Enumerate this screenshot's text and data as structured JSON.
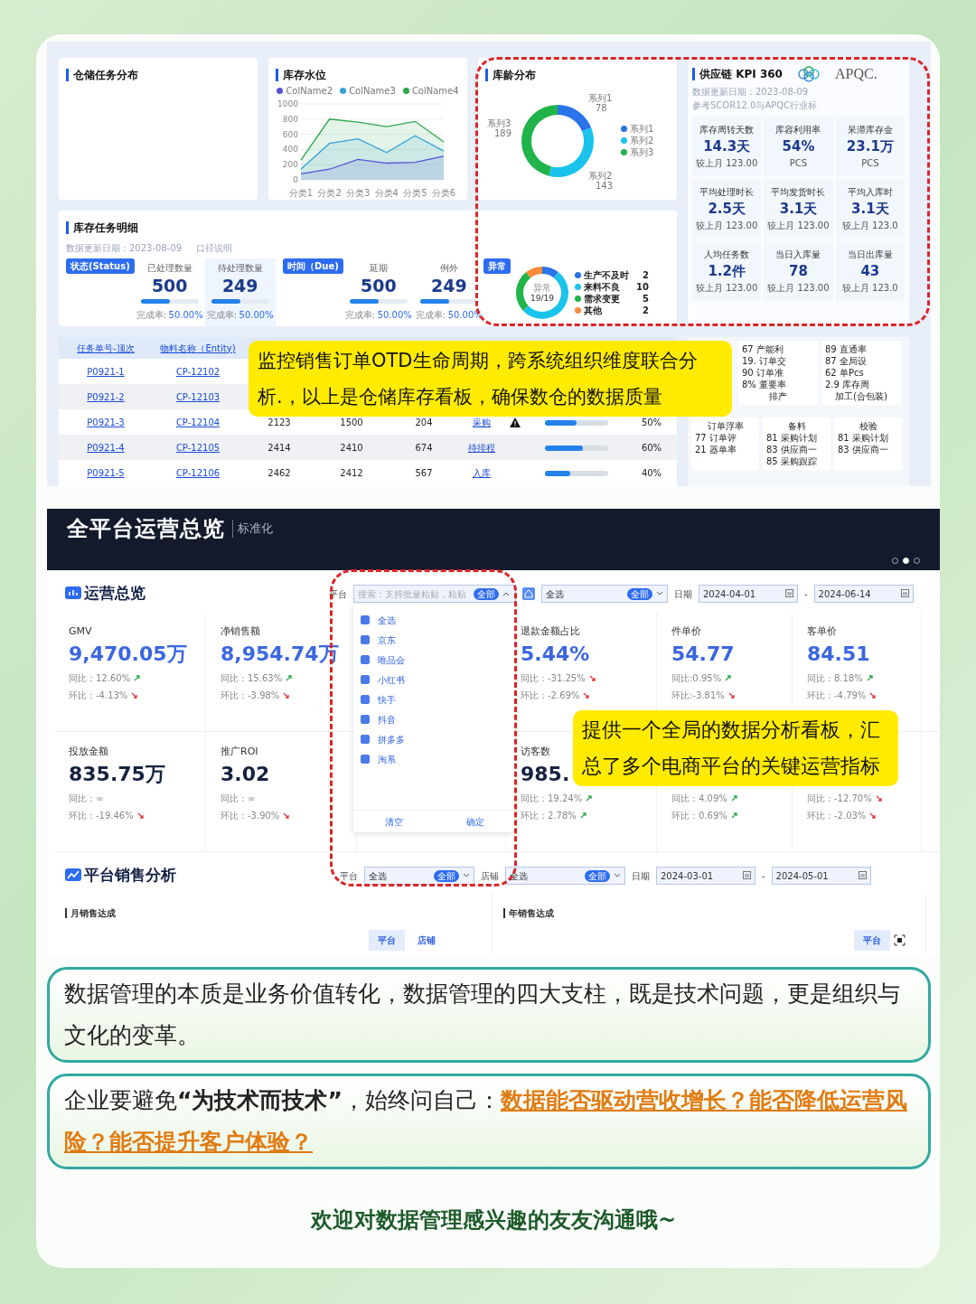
{
  "warehouse": {
    "task_panel": {
      "title": "仓储任务分布"
    },
    "level_panel": {
      "title": "库存水位",
      "chart_data": {
        "type": "area",
        "legend": "top",
        "grid": true,
        "categories": [
          "分类1",
          "分类2",
          "分类3",
          "分类4",
          "分类5",
          "分类6"
        ],
        "ylim": [
          0,
          1000
        ],
        "yticks": [
          0,
          200,
          400,
          600,
          800,
          1000
        ],
        "series": [
          {
            "name": "ColName2",
            "color": "#5552d9",
            "values": [
              80,
              140,
              270,
              220,
              230,
              310
            ]
          },
          {
            "name": "ColName3",
            "color": "#35a3d8",
            "values": [
              140,
              480,
              540,
              360,
              580,
              380
            ]
          },
          {
            "name": "ColName4",
            "color": "#2aa84a",
            "values": [
              260,
              800,
              760,
              700,
              770,
              500
            ]
          }
        ]
      }
    },
    "age_panel": {
      "title": "库龄分布",
      "chart_data": {
        "type": "donut",
        "legend": "right",
        "categories": [
          "系列1",
          "系列2",
          "系列3"
        ],
        "series": [
          {
            "values": [
              78,
              143,
              189
            ]
          }
        ],
        "data_labels": true
      }
    },
    "detail": {
      "title": "库存任务明细",
      "update": "数据更新日期：2023-08-09",
      "caliber": "口径说明",
      "groups": [
        {
          "tag": "状态(Status)",
          "stats": [
            {
              "label": "已处理数量",
              "value": "500",
              "level": 0.5,
              "rate_label": "完成率:",
              "rate": "50.00%",
              "selected": false
            },
            {
              "label": "待处理数量",
              "value": "249",
              "level": 0.5,
              "rate_label": "完成率:",
              "rate": "50.00%",
              "selected": true
            }
          ]
        },
        {
          "tag": "时间（Due)",
          "stats": [
            {
              "label": "延期",
              "value": "500",
              "level": 0.5,
              "rate_label": "完成率:",
              "rate": "50.00%",
              "selected": false
            },
            {
              "label": "例外",
              "value": "249",
              "level": 0.5,
              "rate_label": "完成率:",
              "rate": "50.00%",
              "selected": false
            }
          ]
        }
      ],
      "exception": {
        "tag": "异常",
        "center_label": "异常",
        "center_value": "19/19",
        "chart_data": {
          "type": "donut",
          "legend": "right",
          "categories": [
            "生产不及时",
            "来料不良",
            "需求变更",
            "其他"
          ],
          "series": [
            {
              "values": [
                2,
                10,
                5,
                2
              ]
            }
          ],
          "data_labels": true
        }
      }
    },
    "table": {
      "columns": [
        "任务单号-顶次",
        "物料名称（Entity)"
      ],
      "rows": [
        {
          "task": "P0921-1",
          "material": "CP-12102"
        },
        {
          "task": "P0921-2",
          "material": "CP-12103"
        },
        {
          "task": "P0921-3",
          "material": "CP-12104",
          "col_3": "2123",
          "col_4": "1500",
          "col_5": "204",
          "stage": "采购",
          "warning": true,
          "level": 0.5,
          "percent": "50%"
        },
        {
          "task": "P0921-4",
          "material": "CP-12105",
          "col_3": "2414",
          "col_4": "2410",
          "col_5": "674",
          "stage": "待排程",
          "warning": false,
          "level": 0.6,
          "percent": "60%"
        },
        {
          "task": "P0921-5",
          "material": "CP-12106",
          "col_3": "2462",
          "col_4": "2412",
          "col_5": "567",
          "stage": "入库",
          "warning": false,
          "level": 0.4,
          "percent": "40%"
        }
      ]
    },
    "kpi": {
      "title": "供应链 KPI 360",
      "logo_text": "APQC.",
      "update": "数据更新日期：2023-08-09",
      "reference": "参考SCOR12.0与APQC行业标",
      "cards": [
        {
          "label": "库存周转天数",
          "value": "14.3天",
          "sub": "较上月 123.00"
        },
        {
          "label": "库容利用率",
          "value": "54%",
          "sub": "PCS"
        },
        {
          "label": "呆滞库存金",
          "value": "23.1万",
          "sub": "PCS"
        },
        {
          "label": "平均处理时长",
          "value": "2.5天",
          "sub": "较上月 123.00"
        },
        {
          "label": "平均发货时长",
          "value": "3.1天",
          "sub": "较上月 123.00"
        },
        {
          "label": "平均入库时",
          "value": "3.1天",
          "sub": "较上月 123.0"
        },
        {
          "label": "人均任务数",
          "value": "1.2件",
          "sub": "较上月 123.00"
        },
        {
          "label": "当日入库量",
          "value": "78",
          "sub": "较上月 123.00"
        },
        {
          "label": "当日出库量",
          "value": "43",
          "sub": "较上月 123.0"
        }
      ]
    },
    "kpi_tree": [
      {
        "items": [
          "67 产能利",
          "19. 订单交",
          "90 订单准",
          "8% 董要率"
        ],
        "footer": "排产"
      },
      {
        "items": [
          "89 直通率",
          "87 全局设",
          "62 单Pcs",
          "2.9 库存周"
        ],
        "footer": "加工(合包装)"
      },
      {
        "heading": "订单浮率",
        "items": [
          "77 订单评",
          "21 器单率"
        ]
      },
      {
        "heading": "备料",
        "items": [
          "81 采购计划",
          "83 供应商一",
          "85 采购跟踪"
        ]
      },
      {
        "heading": "校验",
        "items": [
          "81 采购计划",
          "83 供应商一"
        ]
      }
    ],
    "callout": "监控销售订单OTD生命周期，跨系统组织维度联合分析.，以上是仓储库存看板，确保数仓的数据质量"
  },
  "operations": {
    "header": {
      "title": "全平台运营总览",
      "subtitle": "标准化",
      "pager": [
        {
          "selected": false
        },
        {
          "selected": true
        },
        {
          "selected": false
        }
      ]
    },
    "overview": {
      "title": "运营总览",
      "platform_filter": {
        "label": "平台",
        "placeholder": "搜索：支持批量粘贴，粘贴",
        "tag": "全部",
        "expanded": true,
        "options": [
          {
            "label": "全选",
            "checked": true
          },
          {
            "label": "京东",
            "checked": true
          },
          {
            "label": "唯品会",
            "checked": true
          },
          {
            "label": "小红书",
            "checked": true
          },
          {
            "label": "快手",
            "checked": true
          },
          {
            "label": "抖音",
            "checked": true
          },
          {
            "label": "拼多多",
            "checked": true
          },
          {
            "label": "淘系",
            "checked": true
          }
        ],
        "actions": [
          "清空",
          "确定"
        ]
      },
      "shop_filter": {
        "value": "全选",
        "tag": "全部"
      },
      "date_filter": {
        "label": "日期",
        "from": "2024-04-01",
        "separator": "-",
        "to": "2024-06-14"
      },
      "metric_rows": [
        {
          "kind": "primary",
          "items": [
            {
              "label": "GMV",
              "value": "9,470.05万",
              "yoy": "同比：12.60%",
              "yoy_up": true,
              "mom": "环比：-4.13%",
              "mom_up": false
            },
            {
              "label": "净销售额",
              "value": "8,954.74万",
              "yoy": "同比：15.63%",
              "yoy_up": true,
              "mom": "环比：-3.98%",
              "mom_up": false
            },
            {
              "label": "退款金额占比",
              "value": "5.44%",
              "yoy": "同比：-31.25%",
              "yoy_up": false,
              "mom": "环比：-2.69%",
              "mom_up": false
            },
            {
              "label": "件单价",
              "value": "54.77",
              "yoy": "同比:0.95%",
              "yoy_up": true,
              "mom": "环比:-3.81%",
              "mom_up": false
            },
            {
              "label": "客单价",
              "value": "84.51",
              "yoy": "同比：8.18%",
              "yoy_up": true,
              "mom": "环比：-4.79%",
              "mom_up": false
            }
          ]
        },
        {
          "kind": "secondary",
          "items": [
            {
              "label": "投放金额",
              "value": "835.75万",
              "yoy": "同比：∞",
              "mom": "环比：-19.46%",
              "mom_up": false
            },
            {
              "label": "推广ROI",
              "value": "3.02",
              "yoy": "同比：∞",
              "mom": "环比：-3.90%",
              "mom_up": false
            },
            {
              "label": "访客数",
              "value": "985.",
              "yoy": "同比：19.24%",
              "yoy_up": true,
              "mom": "环比：2.78%",
              "mom_up": true
            },
            {
              "yoy": "同比：4.09%",
              "yoy_up": true,
              "mom": "环比：0.69%",
              "mom_up": true
            },
            {
              "yoy": "同比：-12.70%",
              "yoy_up": false,
              "mom": "环比：-2.03%",
              "mom_up": false
            }
          ]
        }
      ]
    },
    "sales": {
      "title": "平台销售分析",
      "filters": {
        "platform_label": "平台",
        "platform_value": "全选",
        "platform_tag": "全部",
        "shop_label": "店铺",
        "shop_value": "全选",
        "shop_tag": "全部",
        "date_label": "日期",
        "from": "2024-03-01",
        "separator": "-",
        "to": "2024-05-01"
      },
      "panels": [
        {
          "title": "月销售达成",
          "tabs": [
            {
              "label": "平台",
              "selected": true
            },
            {
              "label": "店铺",
              "selected": false
            }
          ]
        },
        {
          "title": "年销售达成",
          "tabs": [
            {
              "label": "平台",
              "selected": true
            }
          ]
        }
      ]
    },
    "callout": "提供一个全局的数据分析看板，汇总了多个电商平台的关键运营指标"
  },
  "notes": [
    {
      "text": "数据管理的本质是业务价值转化，数据管理的四大支柱，既是技术问题，更是组织与文化的变革。"
    },
    {
      "text": "企业要避免**“为技术而技术”**，始终问自己：",
      "highlight": "数据能否驱动营收增长？能否降低运营风险？能否提升客户体验？"
    }
  ],
  "footer": "欢迎对数据管理感兴趣的友友沟通哦~"
}
